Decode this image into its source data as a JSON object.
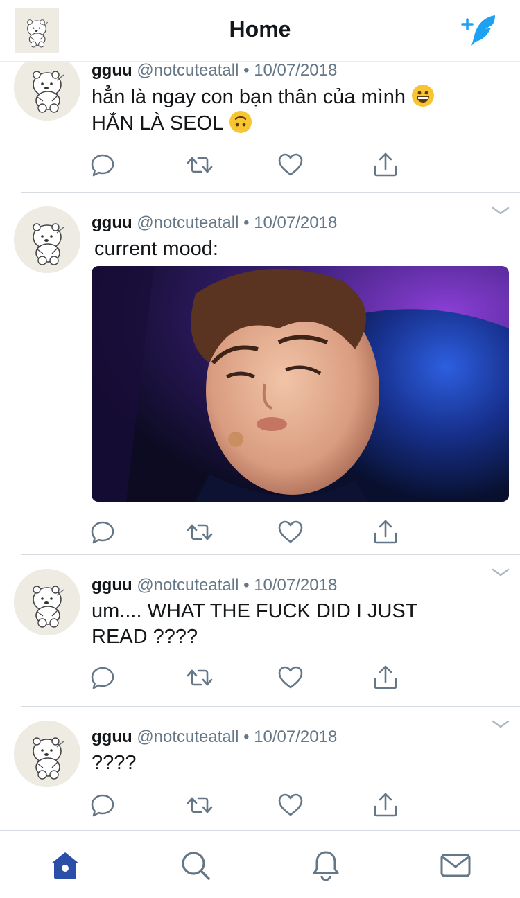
{
  "header": {
    "title": "Home"
  },
  "tweets": [
    {
      "name": "gguu",
      "handle": "@notcuteatall",
      "separator": "•",
      "date": "10/07/2018",
      "lines": [
        "hẳn là ngay con bạn thân của mình",
        "HẲN LÀ SEOL"
      ]
    },
    {
      "name": "gguu",
      "handle": "@notcuteatall",
      "separator": "•",
      "date": "10/07/2018",
      "lines": [
        "current mood:"
      ]
    },
    {
      "name": "gguu",
      "handle": "@notcuteatall",
      "separator": "•",
      "date": "10/07/2018",
      "lines": [
        "um.... WHAT THE FUCK DID I JUST",
        "READ ????"
      ]
    },
    {
      "name": "gguu",
      "handle": "@notcuteatall",
      "separator": "•",
      "date": "10/07/2018",
      "lines": [
        "????"
      ]
    }
  ],
  "icons": {
    "tweet_actions": [
      "reply-icon",
      "retweet-icon",
      "like-icon",
      "share-icon"
    ],
    "tabs": [
      "home-icon",
      "search-icon",
      "notifications-icon",
      "messages-icon"
    ]
  },
  "colors": {
    "accent": "#1da1f2",
    "muted": "#657786",
    "home_active": "#2b4fa8",
    "icon_gray": "#657786",
    "emoji": "#f7c531"
  }
}
